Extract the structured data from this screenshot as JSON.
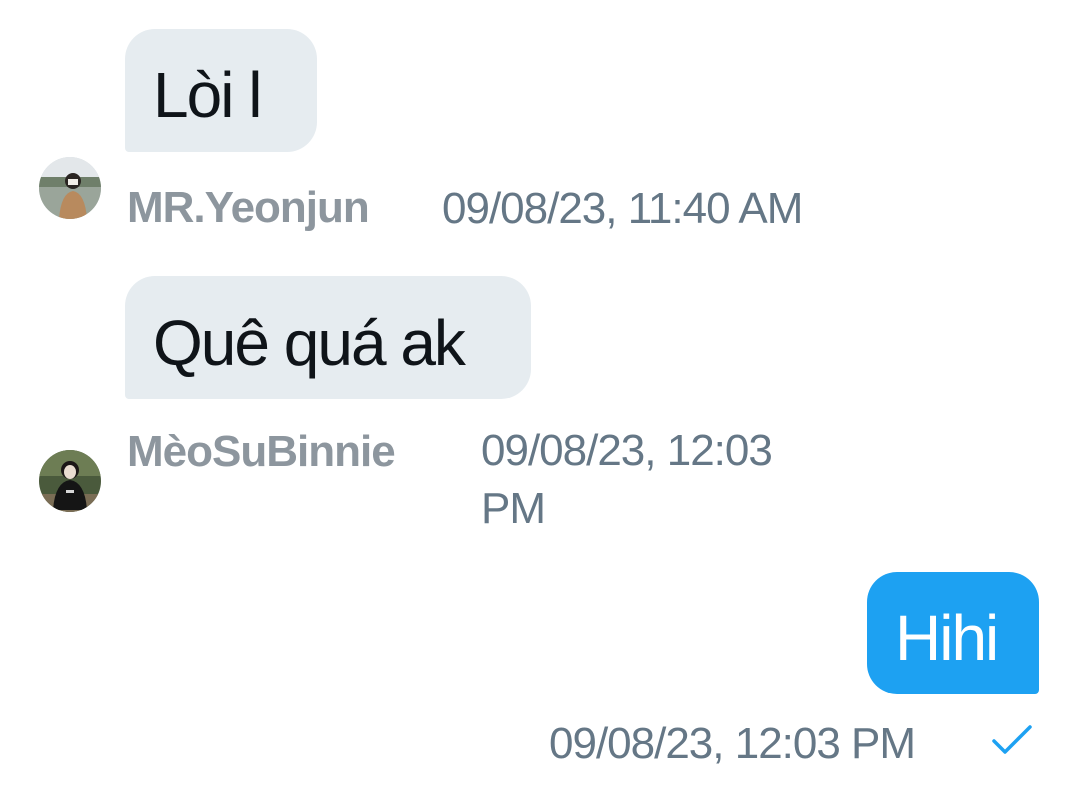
{
  "messages": [
    {
      "text": "Lòi l",
      "direction": "incoming",
      "sender": "MR.Yeonjun",
      "timestamp": "09/08/23, 11:40 AM",
      "avatar": "avatar-photo"
    },
    {
      "text": "Quê quá ak",
      "direction": "incoming",
      "sender": "MèoSuBinnie",
      "timestamp": "09/08/23, 12:03 PM",
      "avatar": "avatar-photo"
    },
    {
      "text": "Hihi",
      "direction": "outgoing",
      "timestamp": "09/08/23, 12:03 PM",
      "status_icon": "checkmark-icon"
    }
  ],
  "colors": {
    "incoming_bubble": "#e6ecf0",
    "outgoing_bubble": "#1da1f2",
    "timestamp": "#657786",
    "sender_name": "#8d969e",
    "check": "#1da1f2"
  }
}
